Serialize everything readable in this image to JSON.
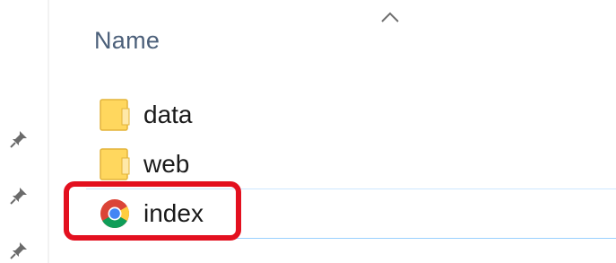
{
  "file_list": {
    "column_header": "Name",
    "items": [
      {
        "name": "data",
        "icon": "folder-icon"
      },
      {
        "name": "web",
        "icon": "folder-icon"
      },
      {
        "name": "index",
        "icon": "chrome-icon"
      }
    ]
  },
  "colors": {
    "header_text": "#4c607a",
    "selection_border": "#99d1ff",
    "annotation_red": "#e3101f",
    "folder_yellow": "#ffe27a"
  }
}
